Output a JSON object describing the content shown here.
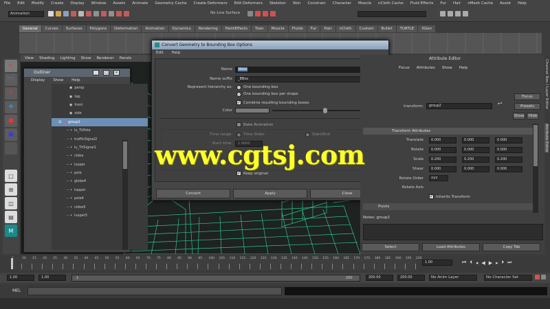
{
  "menubar": {
    "items": [
      "File",
      "Edit",
      "Modify",
      "Create",
      "Display",
      "Window",
      "Assets",
      "Animate",
      "Geometry Cache",
      "Create Deformers",
      "Edit Deformers",
      "Skeleton",
      "Skin",
      "Constrain",
      "Character",
      "Muscle",
      "nCloth Cache",
      "Fluid Effects",
      "Fur",
      "Hair",
      "nMesh Cache",
      "Assist",
      "Help"
    ]
  },
  "status": {
    "mode": "Animation",
    "live_surface": "No Live Surface"
  },
  "shelf": {
    "tabs": [
      "General",
      "Curves",
      "Surfaces",
      "Polygons",
      "Deformation",
      "Animation",
      "Dynamics",
      "Rendering",
      "PaintEffects",
      "Toon",
      "Muscle",
      "Fluids",
      "Fur",
      "Hair",
      "nCloth",
      "Custom",
      "Bullet",
      "TURTLE",
      "XGen"
    ]
  },
  "viewport": {
    "menu": [
      "View",
      "Shading",
      "Lighting",
      "Show",
      "Renderer",
      "Panels"
    ]
  },
  "outliner": {
    "title": "Outliner",
    "menu": [
      "Display",
      "Show",
      "Help"
    ],
    "items": [
      "persp",
      "top",
      "front",
      "side",
      "group2",
      "lu_TitPole",
      "trafficSignal2",
      "lu_TitSignal1",
      "clobe",
      "luoper",
      "pole",
      "globe4",
      "topper",
      "pole4",
      "clobe5",
      "luoper5"
    ]
  },
  "dialog": {
    "title": "Convert Geometry to Bounding Box Options",
    "menu": [
      "Edit",
      "Help"
    ],
    "name_label": "Name",
    "name_value": "bbox",
    "suffix_label": "Name suffix",
    "suffix_value": "_BBox",
    "hierarchy_label": "Represent hierarchy as:",
    "hierarchy_opt1": "One bounding box",
    "hierarchy_opt2": "One bounding box per shape",
    "combine_label": "Combine resulting bounding boxes",
    "color_label": "Color",
    "bake_label": "Bake Animation",
    "time_range_label": "Time range:",
    "time_slider_opt": "Time Slider",
    "start_end_opt": "Start/End",
    "start_time_label": "Start time:",
    "start_time_value": "1.0000",
    "keep_original_label": "Keep original",
    "buttons": {
      "convert": "Convert",
      "apply": "Apply",
      "close": "Close"
    }
  },
  "attribute_editor": {
    "header": "Attribute Editor",
    "menu": [
      "Focus",
      "Attributes",
      "Show",
      "Help"
    ],
    "transform_label": "transform:",
    "transform_value": "group2",
    "side_buttons": [
      "Focus",
      "Presets"
    ],
    "show_hide": [
      "Show",
      "Hide"
    ],
    "section": "Transform Attributes",
    "rows": [
      {
        "label": "Translate",
        "values": [
          "0.000",
          "0.000",
          "0.000"
        ]
      },
      {
        "label": "Rotate",
        "values": [
          "0.000",
          "0.000",
          "0.000"
        ]
      },
      {
        "label": "Scale",
        "values": [
          "0.200",
          "0.200",
          "0.200"
        ]
      },
      {
        "label": "Shear",
        "values": [
          "0.000",
          "0.000",
          "0.000"
        ]
      }
    ],
    "rotate_order_label": "Rotate Order",
    "rotate_order_value": "xyz",
    "rotate_axis_label": "Rotate Axis",
    "inherits_label": "Inherits Transform",
    "pivots": "Pivots",
    "notes": "Notes: group2",
    "buttons": [
      "Select",
      "Load Attributes",
      "Copy Tab"
    ]
  },
  "timeline": {
    "ticks": [
      "1",
      "10",
      "15",
      "20",
      "25",
      "30",
      "35",
      "40",
      "45",
      "50",
      "55",
      "60",
      "65",
      "70",
      "75",
      "80",
      "85",
      "90",
      "95",
      "100",
      "105",
      "110",
      "115",
      "120",
      "125",
      "130",
      "135",
      "140",
      "145",
      "150",
      "155",
      "160",
      "165",
      "170",
      "175",
      "180",
      "185",
      "190",
      "195",
      "200"
    ],
    "current": "1.00"
  },
  "range": {
    "start": "1.00",
    "start2": "1.00",
    "slider_start": "1",
    "slider_end": "200",
    "end1": "200.00",
    "end2": "200.00",
    "anim_layer": "No Anim Layer",
    "char_set": "No Character Set"
  },
  "mel": {
    "label": "MEL"
  },
  "watermark": "www.cgtsj.com",
  "right_tabs": [
    "Channel Box / Layer Editor",
    "Attribute Editor"
  ]
}
